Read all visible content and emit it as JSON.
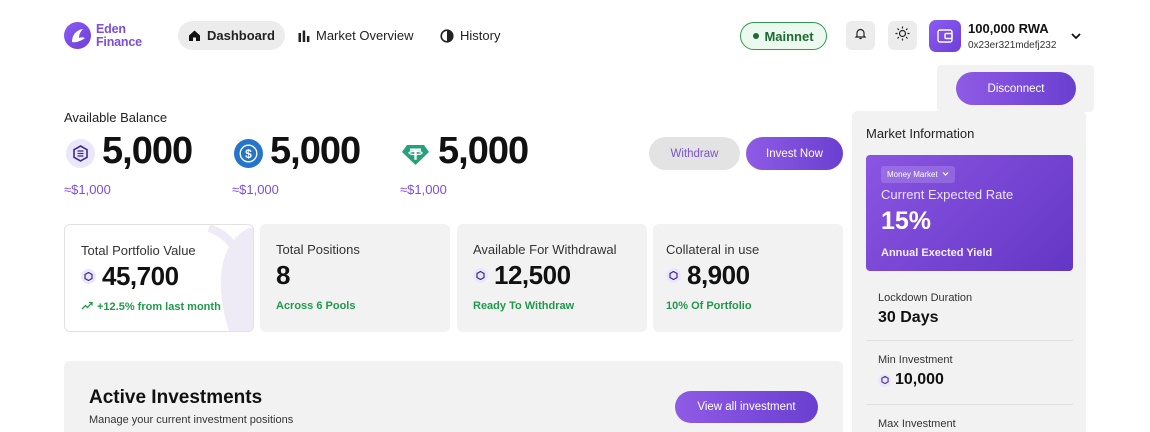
{
  "brand": {
    "line1": "Eden",
    "line2": "Finance",
    "accent": "#7c4ddb"
  },
  "nav": {
    "items": [
      {
        "label": "Dashboard",
        "icon": "home-icon",
        "active": true
      },
      {
        "label": "Market Overview",
        "icon": "bar-chart-icon",
        "active": false
      },
      {
        "label": "History",
        "icon": "history-icon",
        "active": false
      }
    ]
  },
  "network": {
    "label": "Mainnet",
    "color": "#2e9b4f"
  },
  "header_icons": [
    "bell-icon",
    "sun-icon"
  ],
  "wallet": {
    "balance": "100,000 RWA",
    "address": "0x23er321mdefj232",
    "disconnect_label": "Disconnect"
  },
  "balances": {
    "label": "Available Balance",
    "tokens": [
      {
        "icon": "eden-token-icon",
        "amount": "5,000",
        "usd": "≈$1,000"
      },
      {
        "icon": "usdc-icon",
        "amount": "5,000",
        "usd": "≈$1,000"
      },
      {
        "icon": "usdt-icon",
        "amount": "5,000",
        "usd": "≈$1,000"
      }
    ],
    "withdraw_label": "Withdraw",
    "invest_label": "Invest Now"
  },
  "stats": [
    {
      "title": "Total Portfolio Value",
      "value": "45,700",
      "sub": "+12.5% from last month"
    },
    {
      "title": "Total Positions",
      "value": "8",
      "sub": "Across 6 Pools"
    },
    {
      "title": "Available For Withdrawal",
      "value": "12,500",
      "sub": "Ready To Withdraw"
    },
    {
      "title": "Collateral in use",
      "value": "8,900",
      "sub": "10% Of Portfolio"
    }
  ],
  "active_investments": {
    "title": "Active Investments",
    "subtitle": "Manage your current investment positions",
    "view_all_label": "View all investment"
  },
  "market_info": {
    "title": "Market Information",
    "tag": "Money Market",
    "rate_label": "Current Expected Rate",
    "rate_value": "15%",
    "yield_label": "Annual Exected Yield",
    "rows": [
      {
        "label": "Lockdown Duration",
        "value": "30 Days"
      },
      {
        "label": "Min Investment",
        "value": "10,000"
      },
      {
        "label": "Max Investment",
        "value": ""
      }
    ]
  }
}
